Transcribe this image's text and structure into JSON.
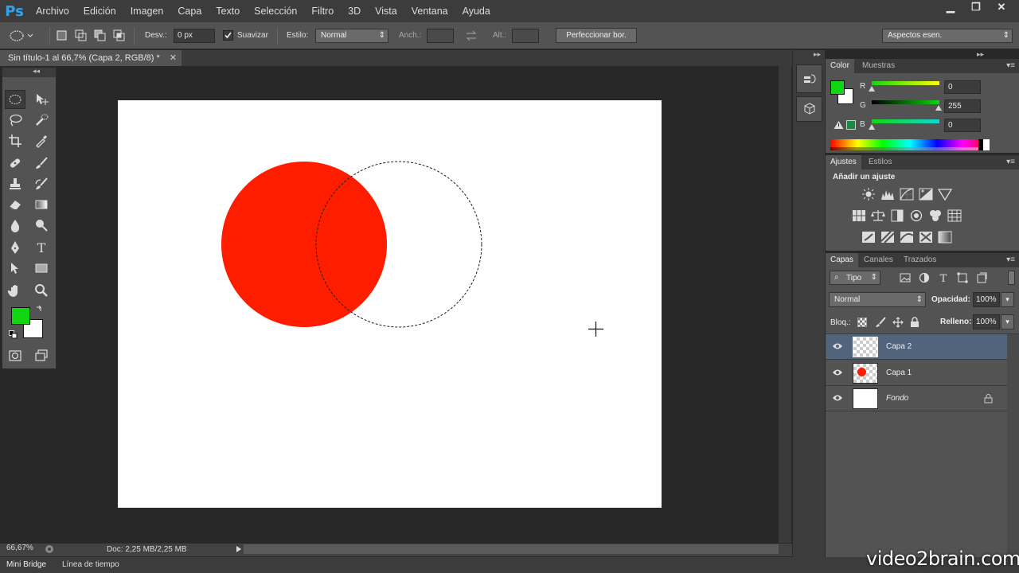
{
  "app": {
    "logo": "Ps",
    "colors": {
      "logo": "#2fa3f0",
      "fg_swatch": "#11d611",
      "bg_swatch": "#ffffff",
      "circle": "#ff1d00",
      "active_layer": "#52647c"
    }
  },
  "menu": [
    "Archivo",
    "Edición",
    "Imagen",
    "Capa",
    "Texto",
    "Selección",
    "Filtro",
    "3D",
    "Vista",
    "Ventana",
    "Ayuda"
  ],
  "window_controls": [
    "minimize-icon",
    "restore-icon",
    "close-icon"
  ],
  "options": {
    "desv_label": "Desv.:",
    "desv_value": "0 px",
    "suavizar_label": "Suavizar",
    "suavizar_checked": true,
    "estilo_label": "Estilo:",
    "estilo_value": "Normal",
    "anch_label": "Anch.:",
    "alt_label": "Alt.:",
    "refine_button": "Perfeccionar bor.",
    "workspace": "Aspectos esen."
  },
  "document": {
    "tab_title": "Sin título-1 al 66,7% (Capa 2, RGB/8) *",
    "zoom": "66,67%",
    "doc_info": "Doc: 2,25 MB/2,25 MB"
  },
  "bottom_tabs": [
    "Mini Bridge",
    "Línea de tiempo"
  ],
  "color_panel": {
    "tabs": [
      "Color",
      "Muestras"
    ],
    "channels": [
      {
        "label": "R",
        "value": "0"
      },
      {
        "label": "G",
        "value": "255"
      },
      {
        "label": "B",
        "value": "0"
      }
    ]
  },
  "adjustments_panel": {
    "tabs": [
      "Ajustes",
      "Estilos"
    ],
    "heading": "Añadir un ajuste"
  },
  "layers_panel": {
    "tabs": [
      "Capas",
      "Canales",
      "Trazados"
    ],
    "filter_label": "Tipo",
    "blend_mode": "Normal",
    "opacity_label": "Opacidad:",
    "opacity_value": "100%",
    "lock_label": "Bloq.:",
    "fill_label": "Relleno:",
    "fill_value": "100%",
    "layers": [
      {
        "name": "Capa 2",
        "active": true
      },
      {
        "name": "Capa 1",
        "active": false
      },
      {
        "name": "Fondo",
        "active": false,
        "locked": true
      }
    ]
  },
  "watermark": "video2brain.com"
}
